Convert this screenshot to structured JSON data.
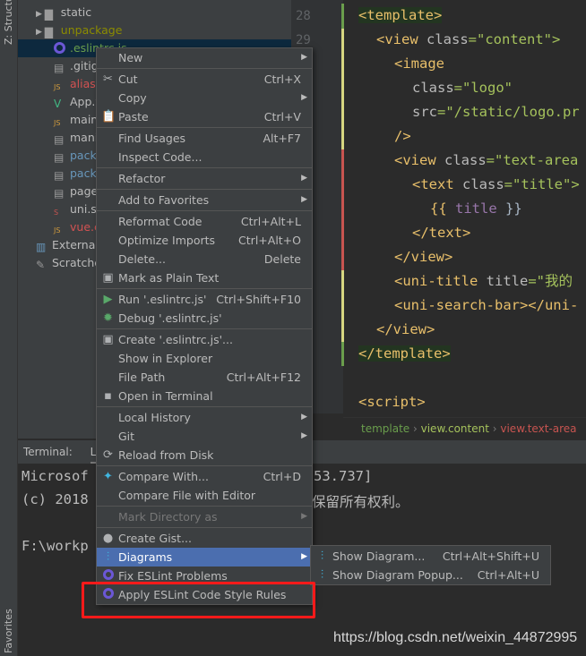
{
  "left_strip": {
    "structure": "Z: Structure",
    "favorites": "Favorites"
  },
  "tree": {
    "items": [
      {
        "label": "static",
        "type": "folder",
        "color": "#bbbbbb"
      },
      {
        "label": "unpackage",
        "type": "folder",
        "color": "#8c8c00"
      },
      {
        "label": ".eslintrc.js",
        "type": "eslint",
        "color": "#6a9e4c",
        "selected": true
      },
      {
        "label": ".gitig",
        "type": "file",
        "color": "#bbbbbb"
      },
      {
        "label": "alias.",
        "type": "js",
        "color": "#d25252"
      },
      {
        "label": "App.v",
        "type": "vue",
        "color": "#bbbbbb"
      },
      {
        "label": "main.",
        "type": "js",
        "color": "#bbbbbb"
      },
      {
        "label": "manif",
        "type": "json",
        "color": "#bbbbbb"
      },
      {
        "label": "packa",
        "type": "json",
        "color": "#6897bb"
      },
      {
        "label": "packa",
        "type": "json",
        "color": "#6897bb"
      },
      {
        "label": "page",
        "type": "json",
        "color": "#bbbbbb"
      },
      {
        "label": "uni.sc",
        "type": "sass",
        "color": "#bbbbbb"
      },
      {
        "label": "vue.c",
        "type": "js",
        "color": "#d25252"
      },
      {
        "label": "External",
        "type": "library",
        "color": "#bbbbbb"
      },
      {
        "label": "Scratche",
        "type": "scratch",
        "color": "#bbbbbb"
      }
    ]
  },
  "editor": {
    "line_numbers": [
      "28",
      "29"
    ],
    "lines": [
      [
        "<template>"
      ],
      [
        "<view ",
        "class",
        "=\"content\">"
      ],
      [
        "<image"
      ],
      [
        "class",
        "=\"logo\""
      ],
      [
        "src",
        "=\"/static/logo.pr"
      ],
      [
        "/>"
      ],
      [
        "<view ",
        "class",
        "=\"text-area"
      ],
      [
        "<text ",
        "class",
        "=\"title\">"
      ],
      [
        "{{ ",
        "title",
        " }}"
      ],
      [
        "</text>"
      ],
      [
        "</view>"
      ],
      [
        "<uni-title ",
        "title",
        "=\"我的"
      ],
      [
        "<uni-search-bar></uni-"
      ],
      [
        "</view>"
      ],
      [
        "</template>"
      ],
      [
        ""
      ],
      [
        "<script>"
      ]
    ],
    "breadcrumb": [
      "template",
      "view.content",
      "view.text-area"
    ]
  },
  "terminal": {
    "tab_label": "Terminal:",
    "tab_local": "Lo",
    "lines": [
      "Microsof",
      "(c) 2018",
      "F:\\workp"
    ],
    "line_tails": [
      "53.737]",
      "保留所有权利。"
    ]
  },
  "context_menu": {
    "items": [
      {
        "label": "New",
        "submenu": true
      },
      {
        "sep": true
      },
      {
        "label": "Cut",
        "shortcut": "Ctrl+X",
        "icon": "scissors-icon"
      },
      {
        "label": "Copy",
        "submenu": true
      },
      {
        "label": "Paste",
        "shortcut": "Ctrl+V",
        "icon": "clipboard-icon"
      },
      {
        "sep": true
      },
      {
        "label": "Find Usages",
        "shortcut": "Alt+F7"
      },
      {
        "label": "Inspect Code..."
      },
      {
        "sep": true
      },
      {
        "label": "Refactor",
        "submenu": true
      },
      {
        "sep": true
      },
      {
        "label": "Add to Favorites",
        "submenu": true
      },
      {
        "sep": true
      },
      {
        "label": "Reformat Code",
        "shortcut": "Ctrl+Alt+L"
      },
      {
        "label": "Optimize Imports",
        "shortcut": "Ctrl+Alt+O"
      },
      {
        "label": "Delete...",
        "shortcut": "Delete"
      },
      {
        "label": "Mark as Plain Text",
        "icon": "plain-text-icon"
      },
      {
        "sep": true
      },
      {
        "label": "Run '.eslintrc.js'",
        "shortcut": "Ctrl+Shift+F10",
        "icon": "run-icon"
      },
      {
        "label": "Debug '.eslintrc.js'",
        "icon": "debug-icon"
      },
      {
        "sep": true
      },
      {
        "label": "Create '.eslintrc.js'...",
        "icon": "create-config-icon"
      },
      {
        "label": "Show in Explorer"
      },
      {
        "label": "File Path",
        "shortcut": "Ctrl+Alt+F12"
      },
      {
        "label": "Open in Terminal",
        "icon": "terminal-icon"
      },
      {
        "sep": true
      },
      {
        "label": "Local History",
        "submenu": true
      },
      {
        "label": "Git",
        "submenu": true
      },
      {
        "label": "Reload from Disk",
        "icon": "reload-icon"
      },
      {
        "sep": true
      },
      {
        "label": "Compare With...",
        "shortcut": "Ctrl+D",
        "icon": "compare-icon"
      },
      {
        "label": "Compare File with Editor"
      },
      {
        "sep": true
      },
      {
        "label": "Mark Directory as",
        "submenu": true,
        "disabled": true
      },
      {
        "sep": true
      },
      {
        "label": "Create Gist...",
        "icon": "github-icon"
      },
      {
        "label": "Diagrams",
        "submenu": true,
        "active": true,
        "icon": "diagram-icon"
      },
      {
        "label": "Fix ESLint Problems",
        "icon": "eslint-icon"
      },
      {
        "label": "Apply ESLint Code Style Rules",
        "icon": "eslint-icon"
      }
    ]
  },
  "submenu": {
    "items": [
      {
        "label": "Show Diagram...",
        "shortcut": "Ctrl+Alt+Shift+U"
      },
      {
        "label": "Show Diagram Popup...",
        "shortcut": "Ctrl+Alt+U"
      }
    ]
  },
  "watermark": "https://blog.csdn.net/weixin_44872995",
  "colors": {
    "highlight": "#4b6eaf",
    "annotation_box": "#ff1a1a"
  }
}
